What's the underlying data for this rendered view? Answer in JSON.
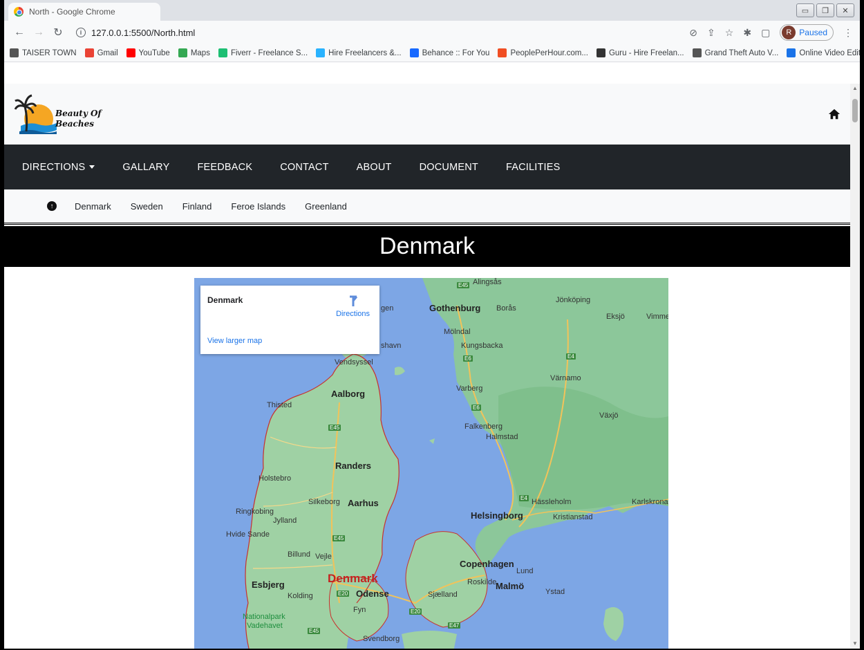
{
  "browser": {
    "tab_title": "North - Google Chrome",
    "url": "127.0.0.1:5500/North.html",
    "profile_initial": "R",
    "profile_label": "Paused",
    "bookmarks": [
      {
        "label": "TAISER TOWN",
        "icon": "globe-icon",
        "color": "#555555"
      },
      {
        "label": "Gmail",
        "icon": "gmail-icon",
        "color": "#ea4335"
      },
      {
        "label": "YouTube",
        "icon": "youtube-icon",
        "color": "#ff0000"
      },
      {
        "label": "Maps",
        "icon": "maps-icon",
        "color": "#34a853"
      },
      {
        "label": "Fiverr - Freelance S...",
        "icon": "fiverr-icon",
        "color": "#1dbf73"
      },
      {
        "label": "Hire Freelancers &...",
        "icon": "freelancer-icon",
        "color": "#29b2fe"
      },
      {
        "label": "Behance :: For You",
        "icon": "behance-icon",
        "color": "#1769ff"
      },
      {
        "label": "PeoplePerHour.com...",
        "icon": "pph-icon",
        "color": "#f04e23"
      },
      {
        "label": "Guru - Hire Freelan...",
        "icon": "guru-icon",
        "color": "#333333"
      },
      {
        "label": "Grand Theft Auto V...",
        "icon": "gta-icon",
        "color": "#555555"
      },
      {
        "label": "Online Video Editor...",
        "icon": "video-editor-icon",
        "color": "#1a73e8"
      }
    ],
    "bookmarks_more": "»"
  },
  "site": {
    "logo_line1": "Beauty Of",
    "logo_line2": "Beaches",
    "nav": [
      {
        "label": "DIRECTIONS",
        "dropdown": true
      },
      {
        "label": "GALLARY"
      },
      {
        "label": "FEEDBACK"
      },
      {
        "label": "CONTACT"
      },
      {
        "label": "ABOUT"
      },
      {
        "label": "DOCUMENT"
      },
      {
        "label": "FACILITIES"
      }
    ],
    "subnav": [
      "Denmark",
      "Sweden",
      "Finland",
      "Feroe Islands",
      "Greenland"
    ],
    "banner": "Denmark"
  },
  "map": {
    "card_place": "Denmark",
    "card_directions": "Directions",
    "card_larger": "View larger map",
    "labels": {
      "alingsas": "Alingsås",
      "gothenburg": "Gothenburg",
      "boras": "Borås",
      "jonkoping": "Jönköping",
      "eksjo": "Eksjö",
      "vimmerby": "Vimme",
      "molndal": "Mölndal",
      "kungsbacka": "Kungsbacka",
      "gen": "gen",
      "shavn": "shavn",
      "vendsyssel": "Vendsyssel",
      "varnamo": "Värnamo",
      "varberg": "Varberg",
      "aalborg": "Aalborg",
      "thisted": "Thisted",
      "vaxjo": "Växjö",
      "falkenberg": "Falkenberg",
      "halmstad": "Halmstad",
      "randers": "Randers",
      "holstebro": "Holstebro",
      "silkeborg": "Silkeborg",
      "aarhus": "Aarhus",
      "hassleholm": "Hässleholm",
      "karlskrona": "Karlskrona",
      "ringkobing": "Ringkobing",
      "jylland": "Jylland",
      "helsingborg": "Helsingborg",
      "kristianstad": "Kristianstad",
      "hvide_sande": "Hvide Sande",
      "billund": "Billund",
      "vejle": "Vejle",
      "copenhagen": "Copenhagen",
      "lund": "Lund",
      "denmark": "Denmark",
      "esbjerg": "Esbjerg",
      "roskilde": "Roskilde",
      "malmo": "Malmö",
      "kolding": "Kolding",
      "odense": "Odense",
      "sjaelland": "Sjælland",
      "ystad": "Ystad",
      "fyn": "Fyn",
      "nationalpark": "Nationalpark",
      "vadehavet": "Vadehavet",
      "svendborg": "Svendborg"
    },
    "highways": {
      "e45a": "E45",
      "e6a": "E6",
      "e4a": "E4",
      "e6b": "E6",
      "e45b": "E45",
      "e4b": "E4",
      "e45c": "E45",
      "e20a": "E20",
      "e20b": "E20",
      "e47": "E47",
      "e45d": "E45"
    }
  }
}
